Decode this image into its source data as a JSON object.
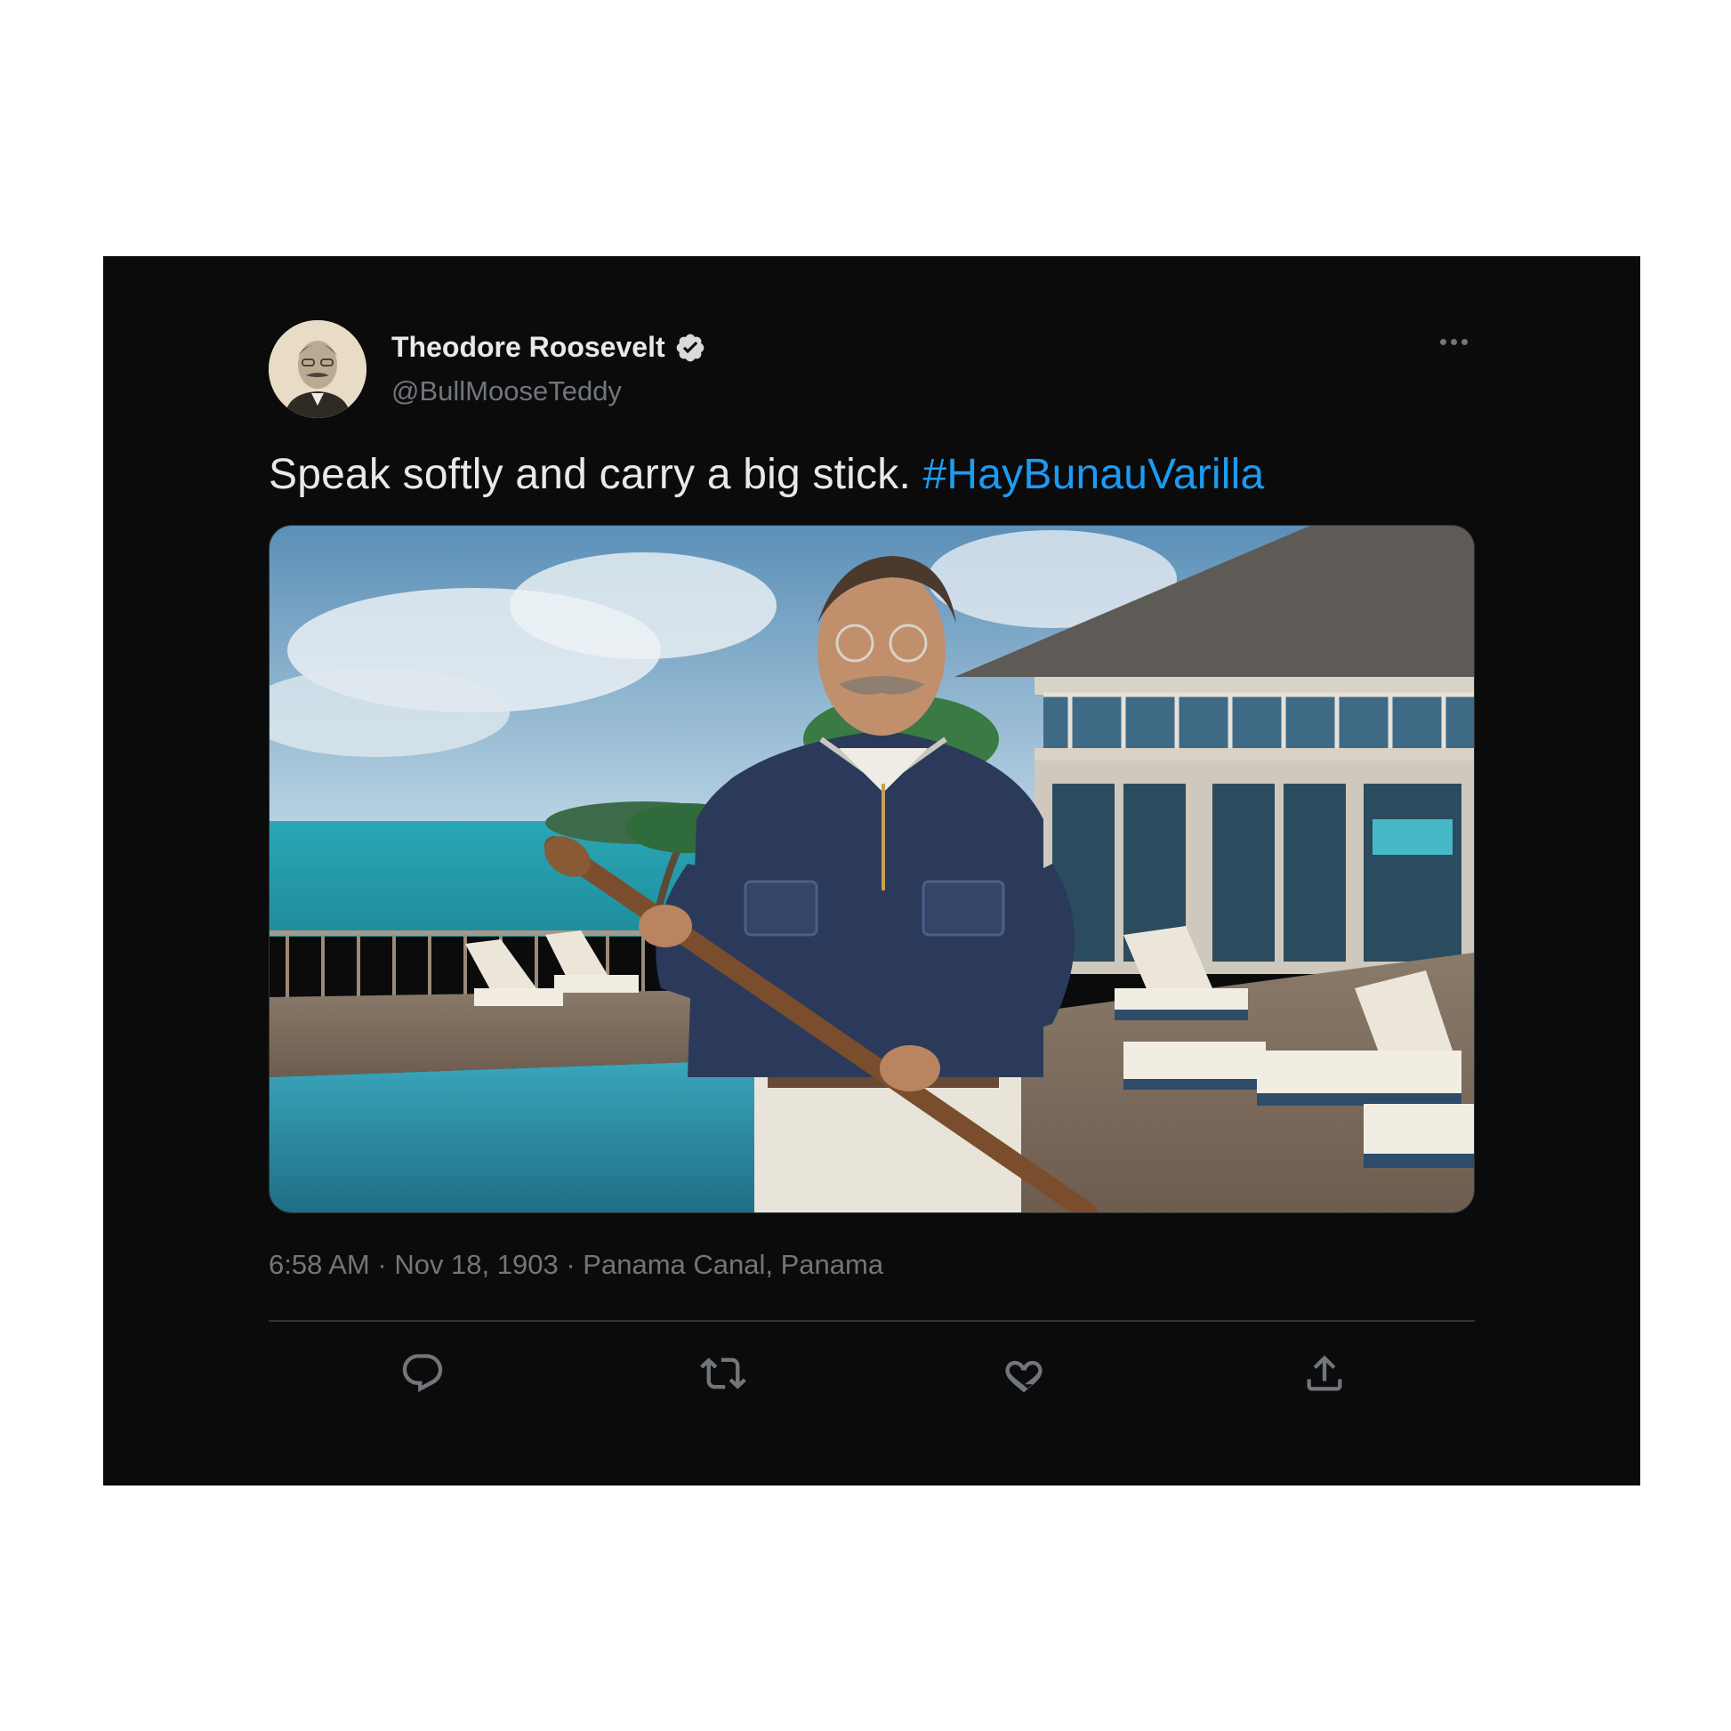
{
  "tweet": {
    "author": {
      "display_name": "Theodore Roosevelt",
      "handle": "@BullMooseTeddy",
      "verified": true,
      "avatar_icon": "portrait-avatar"
    },
    "text": "Speak softly and carry a big stick.",
    "hashtag": "#HayBunauVarilla",
    "media": {
      "type": "image"
    },
    "meta": {
      "time": "6:58 AM",
      "date": "Nov 18, 1903",
      "location": "Panama Canal, Panama",
      "separator": " · "
    },
    "actions": [
      {
        "name": "reply",
        "icon": "reply-icon"
      },
      {
        "name": "retweet",
        "icon": "retweet-icon"
      },
      {
        "name": "like",
        "icon": "heart-icon"
      },
      {
        "name": "share",
        "icon": "share-icon"
      }
    ],
    "more_icon": "more-icon"
  },
  "colors": {
    "card_background": "#0b0b0c",
    "primary_text": "#e7e9ea",
    "secondary_text": "#71767b",
    "link": "#1d9bf0",
    "divider": "#2f3336"
  }
}
